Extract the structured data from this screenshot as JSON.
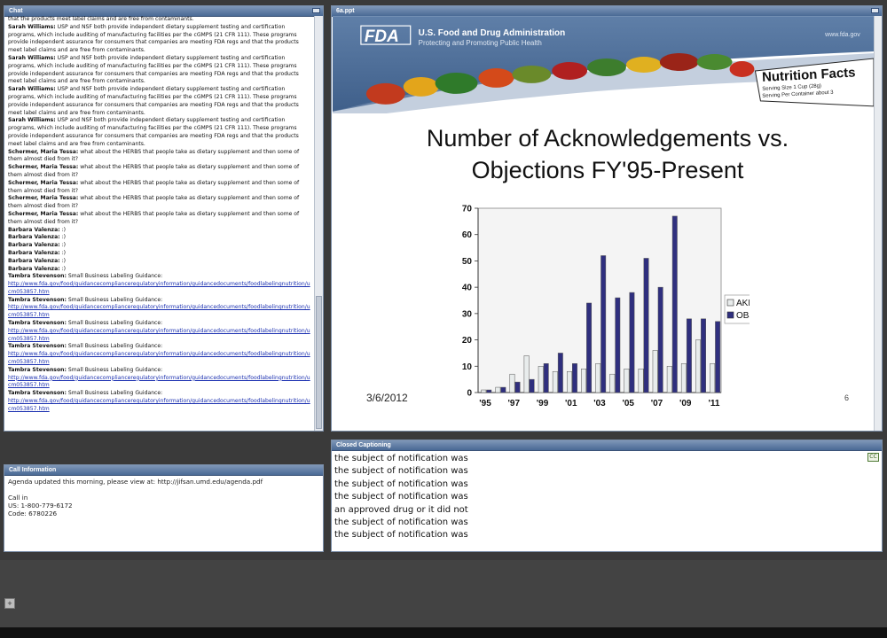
{
  "chat": {
    "title": "Chat",
    "messages": [
      {
        "sender": "",
        "text": "that the products meet label claims and are free from contaminants.",
        "link": ""
      },
      {
        "sender": "Sarah Williams:",
        "text": "USP and NSF both provide independent dietary supplement testing and certification programs, which include auditing of manufacturing facilities per the cGMPS (21 CFR 111). These programs provide independent assurance for consumers that companies are meeting FDA regs and that the products meet label claims and are free from contaminants.",
        "link": ""
      },
      {
        "sender": "Sarah Williams:",
        "text": "USP and NSF both provide independent dietary supplement testing and certification programs, which include auditing of manufacturing facilities per the cGMPS (21 CFR 111). These programs provide independent assurance for consumers that companies are meeting FDA regs and that the products meet label claims and are free from contaminants.",
        "link": ""
      },
      {
        "sender": "Sarah Williams:",
        "text": "USP and NSF both provide independent dietary supplement testing and certification programs, which include auditing of manufacturing facilities per the cGMPS (21 CFR 111). These programs provide independent assurance for consumers that companies are meeting FDA regs and that the products meet label claims and are free from contaminants.",
        "link": ""
      },
      {
        "sender": "Sarah Williams:",
        "text": "USP and NSF both provide independent dietary supplement testing and certification programs, which include auditing of manufacturing facilities per the cGMPS (21 CFR 111). These programs provide independent assurance for consumers that companies are meeting FDA regs and that the products meet label claims and are free from contaminants.",
        "link": ""
      },
      {
        "sender": "Schermer, Maria Tessa:",
        "text": "what about the HERBS that people take as dietary supplement and then some of them almost died from it?",
        "link": ""
      },
      {
        "sender": "Schermer, Maria Tessa:",
        "text": "what about the HERBS that people take as dietary supplement and then some of them almost died from it?",
        "link": ""
      },
      {
        "sender": "Schermer, Maria Tessa:",
        "text": "what about the HERBS that people take as dietary supplement and then some of them almost died from it?",
        "link": ""
      },
      {
        "sender": "Schermer, Maria Tessa:",
        "text": "what about the HERBS that people take as dietary supplement and then some of them almost died from it?",
        "link": ""
      },
      {
        "sender": "Schermer, Maria Tessa:",
        "text": "what about the HERBS that people take as dietary supplement and then some of them almost died from it?",
        "link": ""
      },
      {
        "sender": "Barbara Valenza:",
        "text": ":)",
        "link": ""
      },
      {
        "sender": "Barbara Valenza:",
        "text": ":)",
        "link": ""
      },
      {
        "sender": "Barbara Valenza:",
        "text": ":)",
        "link": ""
      },
      {
        "sender": "Barbara Valenza:",
        "text": ":)",
        "link": ""
      },
      {
        "sender": "Barbara Valenza:",
        "text": ":)",
        "link": ""
      },
      {
        "sender": "Barbara Valenza:",
        "text": ":)",
        "link": ""
      },
      {
        "sender": "Tambra Stevenson:",
        "text": "Small Business Labeling Guidance:",
        "link": "http://www.fda.gov/food/guidancecomplianceregulatoryinformation/guidancedocuments/foodlabelingnutrition/ucm053857.htm"
      },
      {
        "sender": "Tambra Stevenson:",
        "text": "Small Business Labeling Guidance:",
        "link": "http://www.fda.gov/food/guidancecomplianceregulatoryinformation/guidancedocuments/foodlabelingnutrition/ucm053857.htm"
      },
      {
        "sender": "Tambra Stevenson:",
        "text": "Small Business Labeling Guidance:",
        "link": "http://www.fda.gov/food/guidancecomplianceregulatoryinformation/guidancedocuments/foodlabelingnutrition/ucm053857.htm"
      },
      {
        "sender": "Tambra Stevenson:",
        "text": "Small Business Labeling Guidance:",
        "link": "http://www.fda.gov/food/guidancecomplianceregulatoryinformation/guidancedocuments/foodlabelingnutrition/ucm053857.htm"
      },
      {
        "sender": "Tambra Stevenson:",
        "text": "Small Business Labeling Guidance:",
        "link": "http://www.fda.gov/food/guidancecomplianceregulatoryinformation/guidancedocuments/foodlabelingnutrition/ucm053857.htm"
      },
      {
        "sender": "Tambra Stevenson:",
        "text": "Small Business Labeling Guidance:",
        "link": "http://www.fda.gov/food/guidancecomplianceregulatoryinformation/guidancedocuments/foodlabelingnutrition/ucm053857.htm"
      }
    ]
  },
  "call_info": {
    "title": "Call Information",
    "text": "Agenda updated this morning, please view at:  http://jifsan.umd.edu/agenda.pdf\n\nCall in\nUS: 1-800-779-6172\n   Code: 6780226"
  },
  "slides": {
    "title": "6a.ppt",
    "agency": "U.S. Food and Drug Administration",
    "tagline": "Protecting and Promoting Public Health",
    "logo_text": "FDA",
    "site": "www.fda.gov",
    "nutrition_title": "Nutrition Facts",
    "nutrition_line1": "Serving Size 1 Cup (28g)",
    "nutrition_line2": "Serving Per Container about 3",
    "slide_title_line1": "Number of Acknowledgements vs.",
    "slide_title_line2": "Objections FY'95-Present",
    "date": "3/6/2012",
    "slide_number": "6"
  },
  "chart_data": {
    "type": "bar",
    "title": "Number of Acknowledgements vs. Objections FY'95-Present",
    "xlabel": "",
    "ylabel": "",
    "ylim": [
      0,
      70
    ],
    "yticks": [
      0,
      10,
      20,
      30,
      40,
      50,
      60,
      70
    ],
    "categories": [
      "'95",
      "'96",
      "'97",
      "'98",
      "'99",
      "'00",
      "'01",
      "'02",
      "'03",
      "'04",
      "'05",
      "'06",
      "'07",
      "'08",
      "'09",
      "'10",
      "'11"
    ],
    "x_tick_labels": [
      "'95",
      "",
      "'97",
      "",
      "'99",
      "",
      "'01",
      "",
      "'03",
      "",
      "'05",
      "",
      "'07",
      "",
      "'09",
      "",
      "'11"
    ],
    "series": [
      {
        "name": "AKL",
        "color": "#e8ecec",
        "values": [
          1,
          2,
          7,
          14,
          10,
          8,
          8,
          9,
          11,
          7,
          9,
          9,
          16,
          10,
          11,
          20,
          11
        ]
      },
      {
        "name": "OBJ",
        "color": "#2f2f7e",
        "values": [
          1,
          2,
          4,
          5,
          11,
          15,
          11,
          34,
          52,
          36,
          38,
          51,
          40,
          67,
          28,
          28,
          27
        ]
      }
    ],
    "legend": "right",
    "grid": false
  },
  "captions": {
    "title": "Closed Captioning",
    "cc_label": "CC",
    "lines": [
      "the subject of notification was",
      "the subject of notification was",
      "the subject of notification was",
      "the subject of notification was",
      "an approved drug or it did not",
      "the subject of notification was",
      "the subject of notification was"
    ]
  },
  "bottom": {
    "add_label": "+"
  }
}
